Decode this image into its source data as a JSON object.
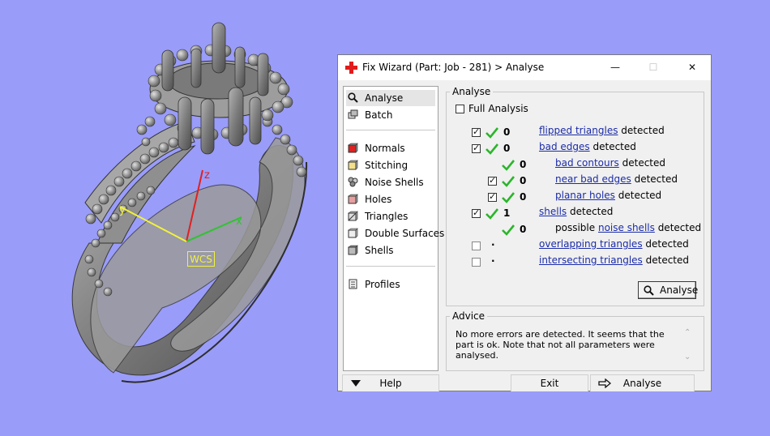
{
  "window": {
    "title": "Fix Wizard (Part: Job - 281) > Analyse",
    "min_label": "—",
    "max_label": "☐",
    "close_label": "✕"
  },
  "viewport": {
    "wcs_label": "WCS",
    "axis_x_label": "x",
    "axis_y_label": "y",
    "axis_z_label": "z",
    "colors": {
      "background": "#9a9cf9",
      "x_axis": "#2ec42e",
      "y_axis": "#f2f23a",
      "z_axis": "#e02020",
      "model": "#8a8a8a"
    }
  },
  "nav": {
    "group1": [
      {
        "label": "Analyse",
        "icon": "magnifier-icon",
        "selected": true
      },
      {
        "label": "Batch",
        "icon": "batch-icon",
        "selected": false
      }
    ],
    "group2": [
      {
        "label": "Normals",
        "icon": "red-cube-icon"
      },
      {
        "label": "Stitching",
        "icon": "stitching-icon"
      },
      {
        "label": "Noise Shells",
        "icon": "noise-shells-icon"
      },
      {
        "label": "Holes",
        "icon": "holes-icon"
      },
      {
        "label": "Triangles",
        "icon": "triangles-icon"
      },
      {
        "label": "Double Surfaces",
        "icon": "double-surfaces-icon"
      },
      {
        "label": "Shells",
        "icon": "shells-icon"
      }
    ],
    "group3": [
      {
        "label": "Profiles",
        "icon": "profiles-icon"
      }
    ]
  },
  "analyse": {
    "group_title": "Analyse",
    "full_analysis_label": "Full Analysis",
    "full_analysis_checked": false,
    "button_label": "Analyse",
    "rows": [
      {
        "checkbox": "checked",
        "status": "ok",
        "count": "0",
        "prefix": "",
        "link": "flipped triangles",
        "suffix": "detected"
      },
      {
        "checkbox": "checked",
        "status": "ok",
        "count": "0",
        "prefix": "",
        "link": "bad edges",
        "suffix": "detected"
      },
      {
        "checkbox": "none",
        "status": "ok",
        "count": "0",
        "prefix": "",
        "link": "bad contours",
        "suffix": "detected"
      },
      {
        "checkbox": "checked",
        "status": "ok",
        "count": "0",
        "prefix": "",
        "link": "near bad edges",
        "suffix": "detected"
      },
      {
        "checkbox": "checked",
        "status": "ok",
        "count": "0",
        "prefix": "",
        "link": "planar holes",
        "suffix": "detected"
      },
      {
        "checkbox": "checked",
        "status": "ok",
        "count": "1",
        "prefix": "",
        "link": "shells",
        "suffix": "detected"
      },
      {
        "checkbox": "none",
        "status": "ok",
        "count": "0",
        "prefix": "possible",
        "link": "noise shells",
        "suffix": "detected"
      },
      {
        "checkbox": "unchecked",
        "status": "pending",
        "count": ".",
        "prefix": "",
        "link": "overlapping triangles",
        "suffix": "detected"
      },
      {
        "checkbox": "unchecked",
        "status": "pending",
        "count": ".",
        "prefix": "",
        "link": "intersecting triangles",
        "suffix": "detected"
      }
    ]
  },
  "advice": {
    "group_title": "Advice",
    "text": "No more errors are detected. It seems that the part is ok. Note that not all parameters were analysed."
  },
  "bottom": {
    "help_label": "Help",
    "exit_label": "Exit",
    "run_label": "Analyse"
  }
}
